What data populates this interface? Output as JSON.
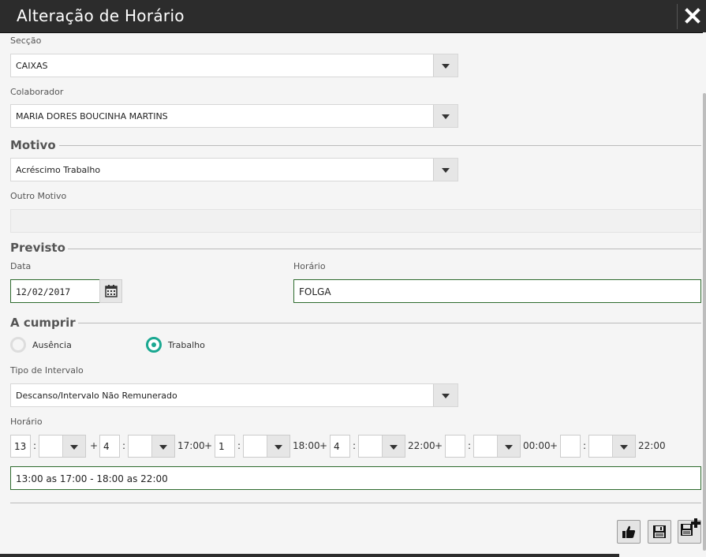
{
  "window": {
    "title": "Alteração de Horário",
    "close_icon": "close-icon"
  },
  "seccao": {
    "label": "Secção",
    "value": "CAIXAS"
  },
  "colaborador": {
    "label": "Colaborador",
    "value": "MARIA DORES BOUCINHA MARTINS"
  },
  "motivo": {
    "section_title": "Motivo",
    "value": "Acréscimo Trabalho",
    "outro_label": "Outro Motivo",
    "outro_value": ""
  },
  "previsto": {
    "section_title": "Previsto",
    "data_label": "Data",
    "data_value": "12/02/2017",
    "horario_label": "Horário",
    "horario_value": "FOLGA"
  },
  "a_cumprir": {
    "section_title": "A cumprir",
    "option_ausencia": "Ausência",
    "option_trabalho": "Trabalho",
    "selected": "Trabalho",
    "tipo_intervalo_label": "Tipo de Intervalo",
    "tipo_intervalo_value": "Descanso/Intervalo Não Remunerado",
    "horario_label": "Horário",
    "schedule": {
      "start_hour": "13",
      "duration1_hour": "4",
      "time1": "17:00",
      "pause1_hour": "1",
      "time2": "18:00",
      "duration2_hour": "4",
      "time3": "22:00",
      "pause2_hour": "",
      "time4": "00:00",
      "duration3_hour": "",
      "time5": "22:00",
      "plus": "+",
      "colon": ":"
    },
    "summary": "13:00 as 17:00 - 18:00 as 22:00"
  },
  "actions": {
    "approve_icon": "thumbs-up-icon",
    "save_icon": "save-icon",
    "save_new_icon": "save-new-icon"
  }
}
